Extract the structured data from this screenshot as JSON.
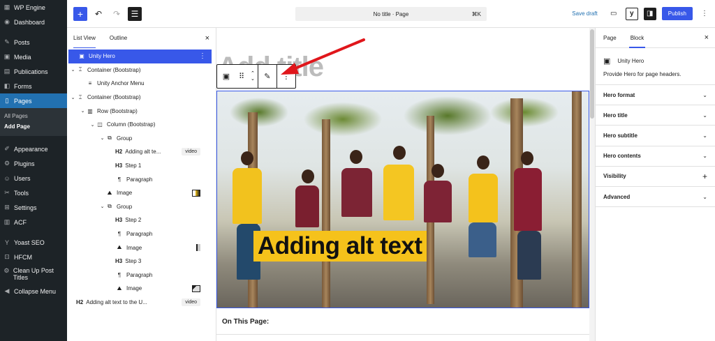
{
  "wp_menu": {
    "items": [
      {
        "icon": "wp-engine-icon",
        "glyph": "▦",
        "label": "WP Engine"
      },
      {
        "icon": "dashboard-icon",
        "glyph": "◉",
        "label": "Dashboard"
      },
      {
        "icon": "posts-icon",
        "glyph": "✎",
        "label": "Posts"
      },
      {
        "icon": "media-icon",
        "glyph": "▣",
        "label": "Media"
      },
      {
        "icon": "publications-icon",
        "glyph": "▤",
        "label": "Publications"
      },
      {
        "icon": "forms-icon",
        "glyph": "◧",
        "label": "Forms"
      },
      {
        "icon": "pages-icon",
        "glyph": "▯",
        "label": "Pages"
      },
      {
        "icon": "appearance-icon",
        "glyph": "✐",
        "label": "Appearance"
      },
      {
        "icon": "plugins-icon",
        "glyph": "⚙",
        "label": "Plugins"
      },
      {
        "icon": "users-icon",
        "glyph": "☺",
        "label": "Users"
      },
      {
        "icon": "tools-icon",
        "glyph": "✂",
        "label": "Tools"
      },
      {
        "icon": "settings-icon",
        "glyph": "⊞",
        "label": "Settings"
      },
      {
        "icon": "acf-icon",
        "glyph": "▥",
        "label": "ACF"
      },
      {
        "icon": "yoast-icon",
        "glyph": "Y",
        "label": "Yoast SEO"
      },
      {
        "icon": "hfcm-icon",
        "glyph": "⊡",
        "label": "HFCM"
      },
      {
        "icon": "cleanup-icon",
        "glyph": "⚙",
        "label": "Clean Up Post Titles"
      },
      {
        "icon": "collapse-icon",
        "glyph": "◀",
        "label": "Collapse Menu"
      }
    ],
    "pages_sub": [
      "All Pages",
      "Add Page"
    ]
  },
  "topbar": {
    "add_glyph": "+",
    "undo_glyph": "↶",
    "redo_glyph": "↷",
    "doc_overview_glyph": "☰",
    "command_text": "No title · Page",
    "command_shortcut": "⌘K",
    "save_draft": "Save draft",
    "preview_glyph": "▭",
    "yoast_glyph": "y",
    "settings_glyph": "◨",
    "publish": "Publish",
    "options_glyph": "⋮"
  },
  "list_view": {
    "tab_list": "List View",
    "tab_outline": "Outline",
    "close": "×",
    "rows": [
      {
        "name": "row-unity-hero",
        "caret": "",
        "icon": "▣",
        "heading": "",
        "label": "Unity Hero",
        "selected": true,
        "tag": "",
        "thumb": ""
      },
      {
        "name": "row-container-1",
        "caret": "⌄",
        "icon": "⌶",
        "heading": "",
        "label": "Container (Bootstrap)",
        "tag": "",
        "thumb": ""
      },
      {
        "name": "row-anchor-menu",
        "caret": "",
        "icon": "≡",
        "heading": "",
        "label": "Unity Anchor Menu",
        "tag": "",
        "thumb": "",
        "indent": 1
      },
      {
        "name": "row-container-2",
        "caret": "⌄",
        "icon": "⌶",
        "heading": "",
        "label": "Container (Bootstrap)",
        "tag": "",
        "thumb": ""
      },
      {
        "name": "row-row",
        "caret": "⌄",
        "icon": "▥",
        "heading": "",
        "label": "Row (Bootstrap)",
        "tag": "",
        "thumb": "",
        "indent": 1
      },
      {
        "name": "row-column",
        "caret": "⌄",
        "icon": "◫",
        "heading": "",
        "label": "Column (Bootstrap)",
        "tag": "",
        "thumb": "",
        "indent": 2
      },
      {
        "name": "row-group-1",
        "caret": "⌄",
        "icon": "⧉",
        "heading": "",
        "label": "Group",
        "tag": "",
        "thumb": "",
        "indent": 3
      },
      {
        "name": "row-h2-adding",
        "caret": "",
        "icon": "",
        "heading": "H2",
        "label": "Adding alt te...",
        "tag": "video",
        "thumb": "",
        "indent": 4
      },
      {
        "name": "row-h3-step1",
        "caret": "",
        "icon": "",
        "heading": "H3",
        "label": "Step 1",
        "tag": "",
        "thumb": "",
        "indent": 4
      },
      {
        "name": "row-paragraph-1",
        "caret": "",
        "icon": "¶",
        "heading": "",
        "label": "Paragraph",
        "tag": "",
        "thumb": "",
        "indent": 4
      },
      {
        "name": "row-image-1",
        "caret": "",
        "icon": "⛰",
        "heading": "",
        "label": "Image",
        "tag": "",
        "thumb": "t1",
        "indent": 3
      },
      {
        "name": "row-group-2",
        "caret": "⌄",
        "icon": "⧉",
        "heading": "",
        "label": "Group",
        "tag": "",
        "thumb": "",
        "indent": 3
      },
      {
        "name": "row-h3-step2",
        "caret": "",
        "icon": "",
        "heading": "H3",
        "label": "Step 2",
        "tag": "",
        "thumb": "",
        "indent": 4
      },
      {
        "name": "row-paragraph-2",
        "caret": "",
        "icon": "¶",
        "heading": "",
        "label": "Paragraph",
        "tag": "",
        "thumb": "",
        "indent": 4
      },
      {
        "name": "row-image-2",
        "caret": "",
        "icon": "⛰",
        "heading": "",
        "label": "Image",
        "tag": "",
        "thumb": "t2",
        "indent": 4
      },
      {
        "name": "row-h3-step3",
        "caret": "",
        "icon": "",
        "heading": "H3",
        "label": "Step 3",
        "tag": "",
        "thumb": "",
        "indent": 4
      },
      {
        "name": "row-paragraph-3",
        "caret": "",
        "icon": "¶",
        "heading": "",
        "label": "Paragraph",
        "tag": "",
        "thumb": "",
        "indent": 4
      },
      {
        "name": "row-image-3",
        "caret": "",
        "icon": "⛰",
        "heading": "",
        "label": "Image",
        "tag": "",
        "thumb": "t3",
        "indent": 4
      },
      {
        "name": "row-h2-bottom",
        "caret": "",
        "icon": "",
        "heading": "H2",
        "label": "Adding alt text to the U...",
        "tag": "video",
        "thumb": "",
        "indent": 0
      }
    ]
  },
  "canvas": {
    "title_placeholder": "Add title",
    "hero_text": "Adding alt text",
    "on_this_page": "On This Page:",
    "toolbar": {
      "block_glyph": "▣",
      "drag_glyph": "⠿",
      "up_glyph": "⌃",
      "down_glyph": "⌄",
      "edit_glyph": "✎",
      "more_glyph": "⋮"
    }
  },
  "settings": {
    "tab_page": "Page",
    "tab_block": "Block",
    "close": "×",
    "block_icon_glyph": "▣",
    "block_name": "Unity Hero",
    "block_desc": "Provide Hero for page headers.",
    "panels": [
      {
        "label": "Hero format",
        "control": "⌄"
      },
      {
        "label": "Hero title",
        "control": "⌄"
      },
      {
        "label": "Hero subtitle",
        "control": "⌄"
      },
      {
        "label": "Hero contents",
        "control": "⌄"
      },
      {
        "label": "Visibility",
        "control": "+"
      },
      {
        "label": "Advanced",
        "control": "⌄"
      }
    ]
  },
  "colors": {
    "accent": "#3858e9",
    "admin_bg": "#1d2327",
    "admin_active": "#2271b1",
    "hero_highlight": "#f5c21b",
    "annotation_arrow": "#e0161b"
  }
}
